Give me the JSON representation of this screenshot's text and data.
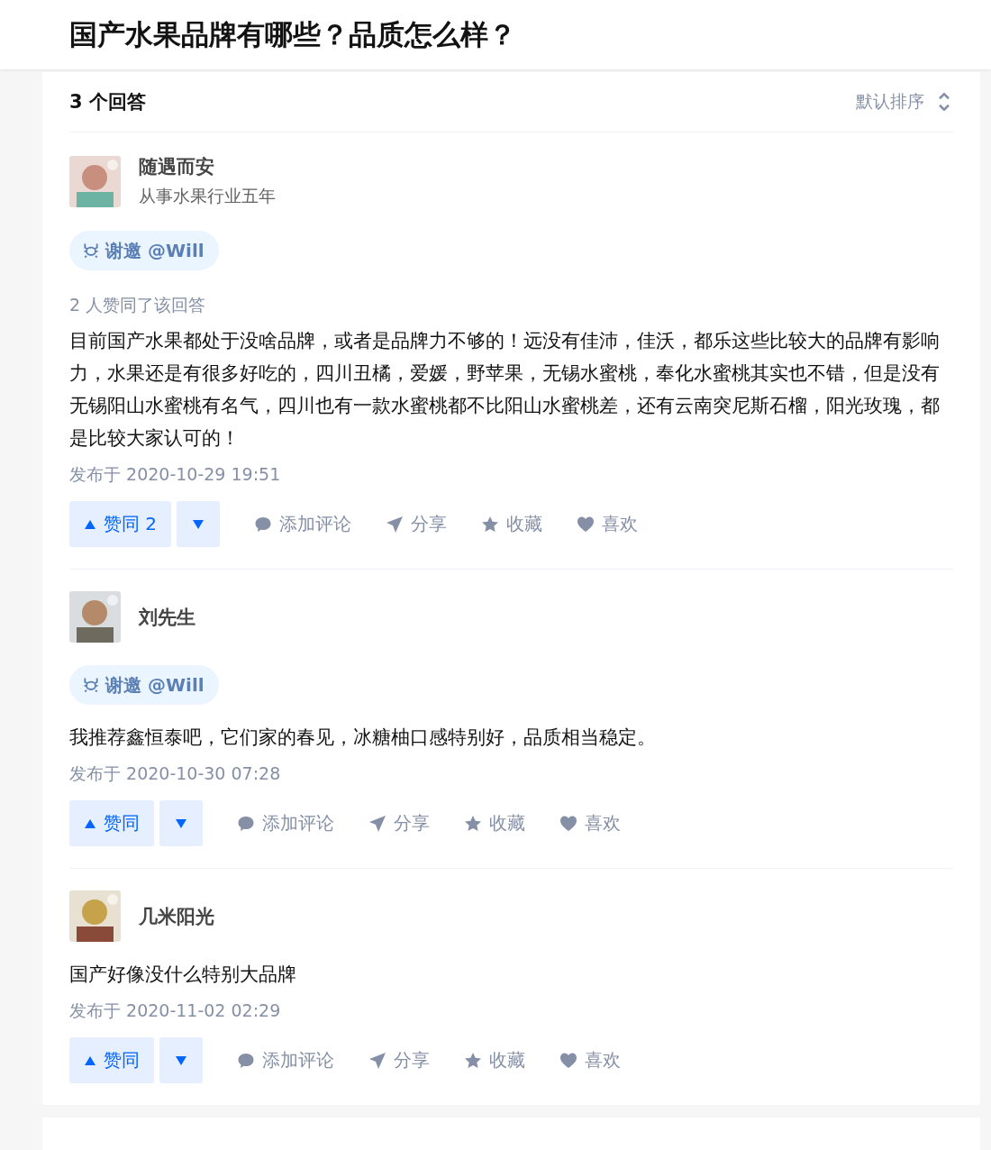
{
  "question": {
    "title": "国产水果品牌有哪些？品质怎么样？"
  },
  "answers_header": {
    "count": "3 个回答",
    "sort": "默认排序"
  },
  "answers": [
    {
      "author": "随遇而安",
      "headline": "从事水果行业五年",
      "invite": "谢邀 @Will",
      "votes_text": "2 人赞同了该回答",
      "content": "目前国产水果都处于没啥品牌，或者是品牌力不够的！远没有佳沛，佳沃，都乐这些比较大的品牌有影响力，水果还是有很多好吃的，四川丑橘，爱媛，野苹果，无锡水蜜桃，奉化水蜜桃其实也不错，但是没有无锡阳山水蜜桃有名气，四川也有一款水蜜桃都不比阳山水蜜桃差，还有云南突尼斯石榴，阳光玫瑰，都是比较大家认可的！",
      "published": "发布于 2020-10-29 19:51",
      "upvote": "赞同 2",
      "actions": [
        {
          "kind": "comment",
          "label": "添加评论"
        },
        {
          "kind": "share",
          "label": "分享"
        },
        {
          "kind": "favorite",
          "label": "收藏"
        },
        {
          "kind": "like",
          "label": "喜欢"
        }
      ]
    },
    {
      "author": "刘先生",
      "invite": "谢邀 @Will",
      "content": "我推荐鑫恒泰吧，它们家的春见，冰糖柚口感特别好，品质相当稳定。",
      "published": "发布于 2020-10-30 07:28",
      "upvote": "赞同",
      "actions": [
        {
          "kind": "comment",
          "label": "添加评论"
        },
        {
          "kind": "share",
          "label": "分享"
        },
        {
          "kind": "favorite",
          "label": "收藏"
        },
        {
          "kind": "like",
          "label": "喜欢"
        }
      ]
    },
    {
      "author": "几米阳光",
      "content": "国产好像没什么特别大品牌",
      "published": "发布于 2020-11-02 02:29",
      "upvote": "赞同",
      "actions": [
        {
          "kind": "comment",
          "label": "添加评论"
        },
        {
          "kind": "share",
          "label": "分享"
        },
        {
          "kind": "favorite",
          "label": "收藏"
        },
        {
          "kind": "like",
          "label": "喜欢"
        }
      ]
    }
  ]
}
